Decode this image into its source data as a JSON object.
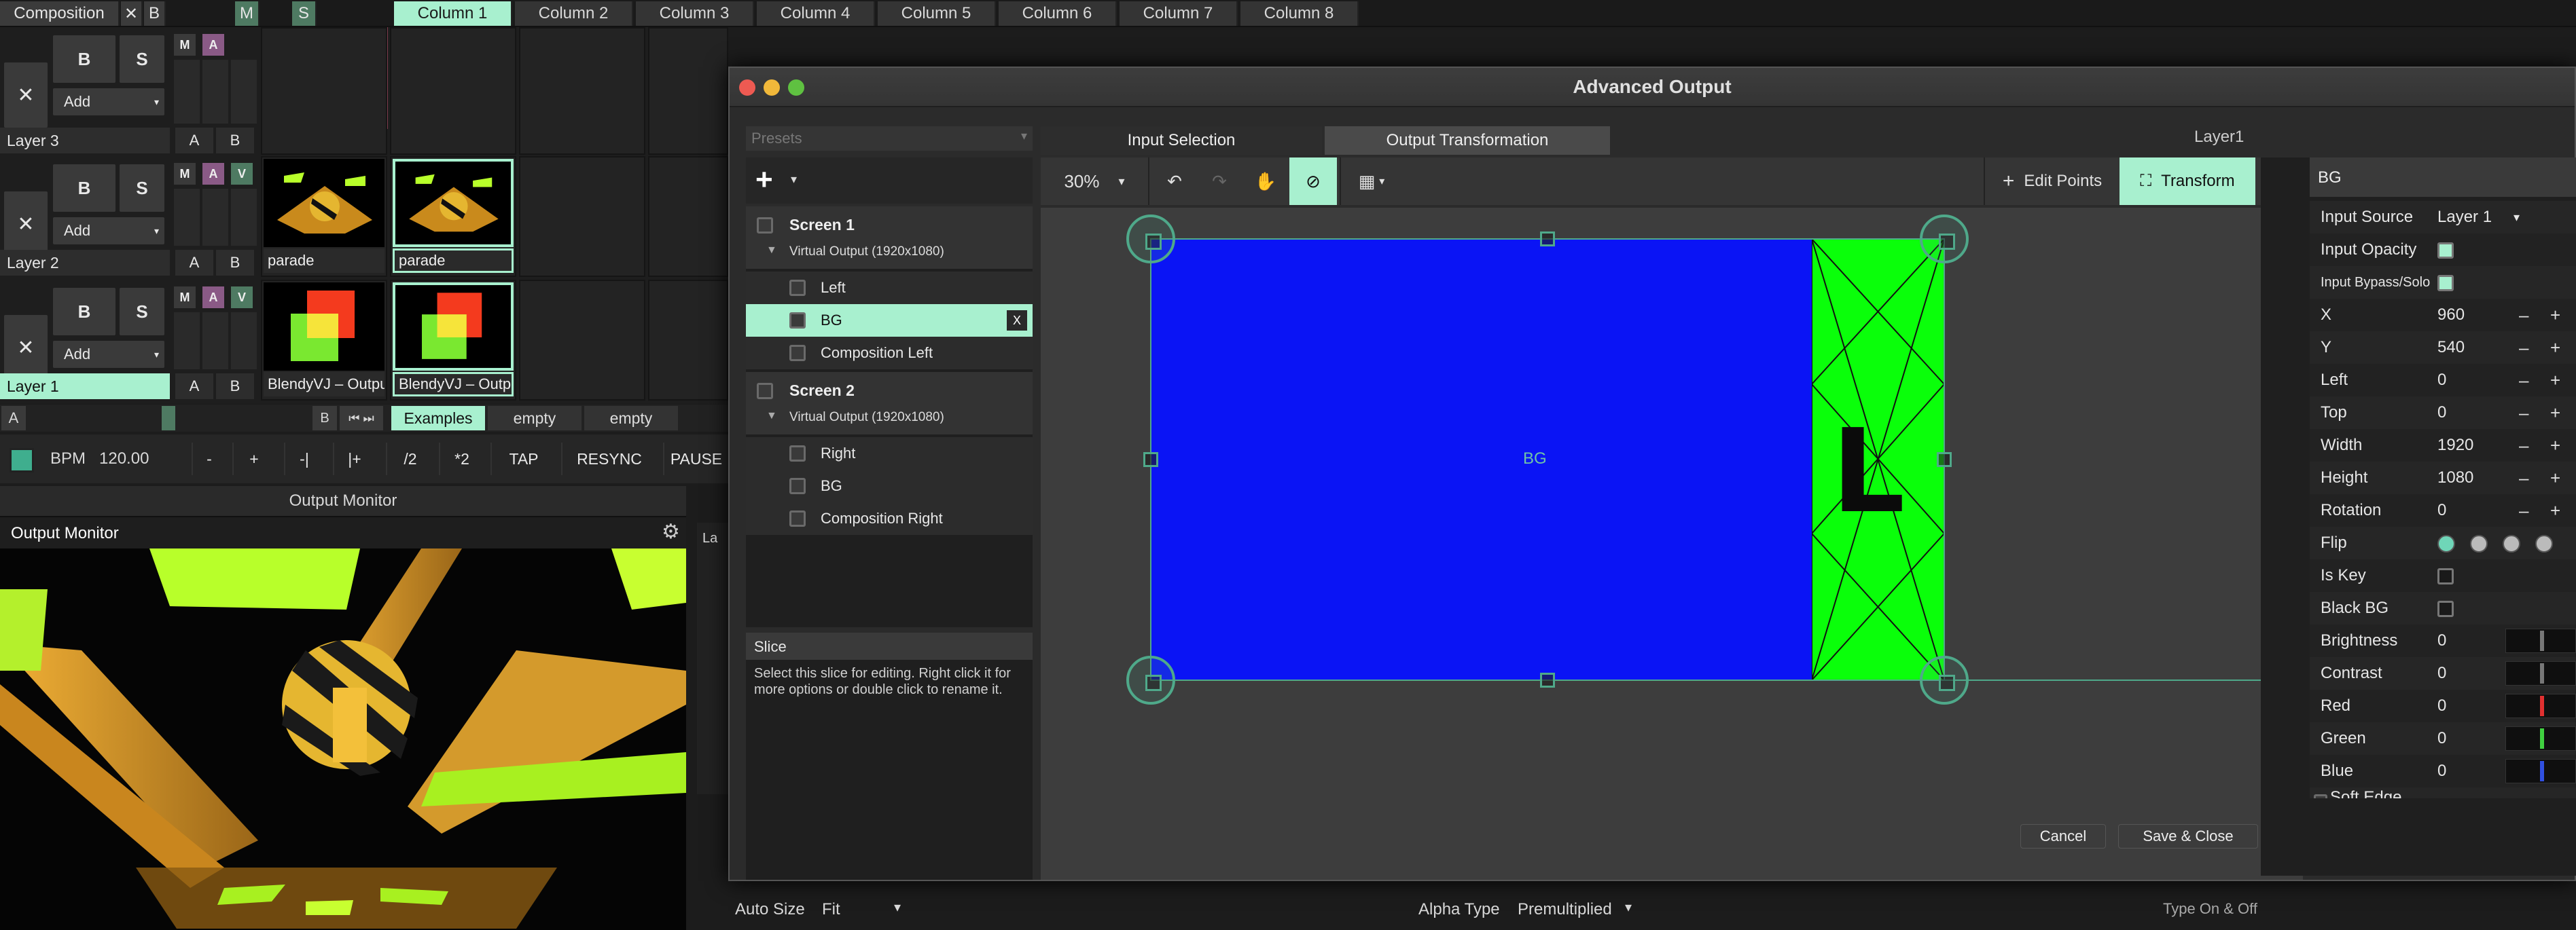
{
  "top_bar": {
    "composition": "Composition",
    "close": "✕",
    "b": "B",
    "m": "M",
    "s": "S",
    "columns": [
      "Column 1",
      "Column 2",
      "Column 3",
      "Column 4",
      "Column 5",
      "Column 6",
      "Column 7",
      "Column 8"
    ]
  },
  "layers": [
    {
      "name": "Layer 3",
      "clips": []
    },
    {
      "name": "Layer 2",
      "clips": [
        "parade",
        "parade"
      ]
    },
    {
      "name": "Layer 1",
      "clips": [
        "BlendyVJ – Output",
        "BlendyVJ – Output"
      ]
    }
  ],
  "layer_controls": {
    "x": "✕",
    "b": "B",
    "s": "S",
    "add": "Add",
    "m": "M",
    "a": "A",
    "v": "V",
    "ab_a": "A",
    "ab_b": "B"
  },
  "deck_bar": {
    "a": "A",
    "b": "B",
    "tabs": [
      "Examples",
      "empty",
      "empty"
    ]
  },
  "transport": {
    "bpm_label": "BPM",
    "bpm_value": "120.00",
    "buttons": [
      "-",
      "+",
      "-|",
      "|+",
      "/2",
      "*2",
      "TAP",
      "RESYNC",
      "PAUSE"
    ]
  },
  "output_monitor": {
    "header": "Output Monitor",
    "title": "Output Monitor",
    "side_text": "La"
  },
  "bottom_bar": {
    "auto_size_label": "Auto Size",
    "auto_size_value": "Fit",
    "alpha_label": "Alpha Type",
    "alpha_value": "Premultiplied",
    "type_on_off": "Type On & Off"
  },
  "dialog": {
    "title": "Advanced Output",
    "presets_placeholder": "Presets",
    "tabs": [
      "Input Selection",
      "Output Transformation"
    ],
    "layer_label": "Layer1",
    "zoom": "30%",
    "edit_points": "Edit Points",
    "transform": "Transform",
    "screens": [
      {
        "name": "Screen 1",
        "sub": "Virtual Output (1920x1080)",
        "slices": [
          "Left",
          "BG",
          "Composition Left"
        ]
      },
      {
        "name": "Screen 2",
        "sub": "Virtual Output (1920x1080)",
        "slices": [
          "Right",
          "BG",
          "Composition Right"
        ]
      }
    ],
    "selected_slice_x": "X",
    "slice_info_title": "Slice",
    "slice_info_text": "Select this slice for editing. Right click it for more options or double click to rename it.",
    "canvas_label": "BG",
    "canvas_letter": "L",
    "cancel": "Cancel",
    "save": "Save & Close",
    "props_title": "BG",
    "props": [
      {
        "label": "Input Source",
        "value": "Layer 1",
        "kind": "dropdown"
      },
      {
        "label": "Input Opacity",
        "value": "",
        "kind": "check-on"
      },
      {
        "label": "Input Bypass/Solo",
        "value": "",
        "kind": "check-on"
      },
      {
        "label": "X",
        "value": "960",
        "kind": "num"
      },
      {
        "label": "Y",
        "value": "540",
        "kind": "num"
      },
      {
        "label": "Left",
        "value": "0",
        "kind": "num"
      },
      {
        "label": "Top",
        "value": "0",
        "kind": "num"
      },
      {
        "label": "Width",
        "value": "1920",
        "kind": "num"
      },
      {
        "label": "Height",
        "value": "1080",
        "kind": "num"
      },
      {
        "label": "Rotation",
        "value": "0",
        "kind": "num"
      },
      {
        "label": "Flip",
        "value": "",
        "kind": "flip"
      },
      {
        "label": "Is Key",
        "value": "",
        "kind": "check"
      },
      {
        "label": "Black BG",
        "value": "",
        "kind": "check"
      },
      {
        "label": "Brightness",
        "value": "0",
        "kind": "slider",
        "color": "#777777"
      },
      {
        "label": "Contrast",
        "value": "0",
        "kind": "slider",
        "color": "#777777"
      },
      {
        "label": "Red",
        "value": "0",
        "kind": "slider",
        "color": "#e03030"
      },
      {
        "label": "Green",
        "value": "0",
        "kind": "slider",
        "color": "#40d040"
      },
      {
        "label": "Blue",
        "value": "0",
        "kind": "slider",
        "color": "#3050e0"
      },
      {
        "label": "Soft Edge",
        "value": "",
        "kind": "partial"
      }
    ],
    "plus_minus": {
      "minus": "–",
      "plus": "+"
    }
  },
  "colors": {
    "accent": "#a8f0cf",
    "canvas_blue": "#0a14f5",
    "canvas_green": "#0aff0a",
    "handle": "#4fa98a"
  }
}
